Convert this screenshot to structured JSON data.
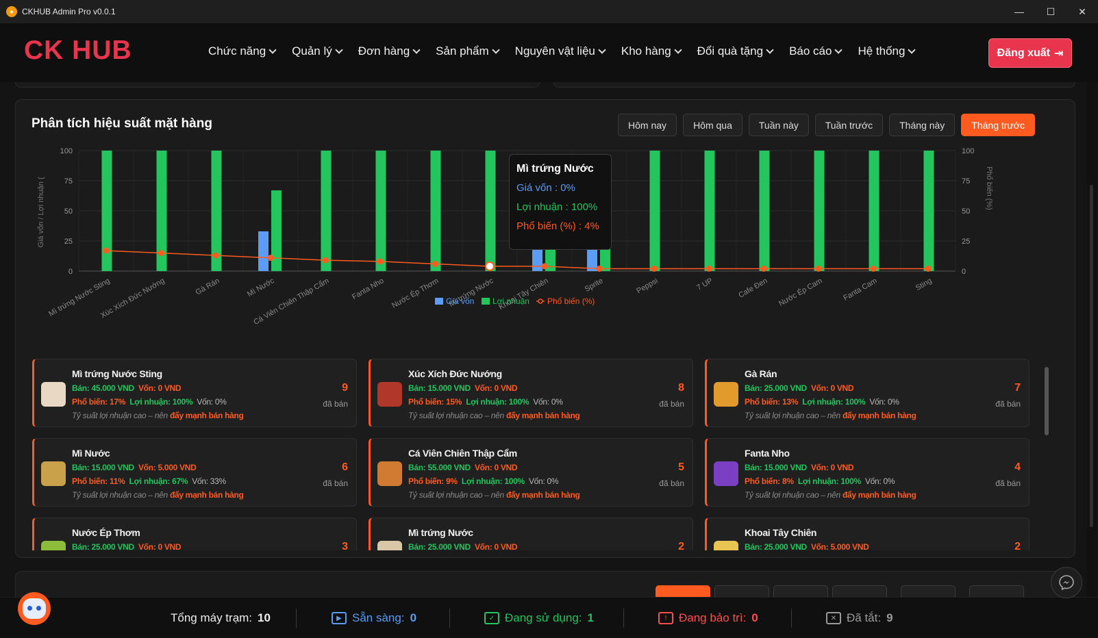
{
  "window": {
    "title": "CKHUB Admin Pro v0.0.1",
    "min": "—",
    "max": "☐",
    "close": "✕"
  },
  "nav": {
    "logo": "CK HUB",
    "menu": [
      "Chức năng",
      "Quản lý",
      "Đơn hàng",
      "Sản phẩm",
      "Nguyên vật liệu",
      "Kho hàng",
      "Đổi quà tặng",
      "Báo cáo",
      "Hệ thống"
    ],
    "logout": "Đăng xuất"
  },
  "panel": {
    "title": "Phân tích hiệu suất mặt hàng",
    "filters": [
      "Hôm nay",
      "Hôm qua",
      "Tuần này",
      "Tuần trước",
      "Tháng này",
      "Tháng trước"
    ],
    "active_filter": "Tháng trước"
  },
  "chart_data": {
    "type": "bar",
    "categories": [
      "Mì trứng Nước Sting",
      "Xúc Xích Đức Nướng",
      "Gà Rán",
      "Mì Nước",
      "Cá Viên Chiên Thập Cẩm",
      "Fanta Nho",
      "Nước Ép Thơm",
      "Mì trứng Nước",
      "Khoai Tây Chiên",
      "Sprite",
      "Peppsi",
      "7 UP",
      "Cafe Đen",
      "Nước Ép Cam",
      "Fanta Cam",
      "Sting"
    ],
    "series": [
      {
        "name": "Giá vốn",
        "type": "bar",
        "axis": "left",
        "color": "#5b9cf5",
        "values": [
          0,
          0,
          0,
          33,
          0,
          0,
          0,
          0,
          20,
          23,
          0,
          0,
          0,
          0,
          0,
          0
        ]
      },
      {
        "name": "Lợi nhuận",
        "type": "bar",
        "axis": "left",
        "color": "#22c55e",
        "values": [
          100,
          100,
          100,
          67,
          100,
          100,
          100,
          100,
          80,
          57,
          100,
          100,
          100,
          100,
          100,
          100
        ]
      },
      {
        "name": "Phổ biến (%)",
        "type": "line",
        "axis": "right",
        "color": "#ff5a1f",
        "values": [
          17,
          15,
          13,
          11,
          9,
          8,
          6,
          4,
          4,
          2,
          2,
          2,
          2,
          2,
          2,
          2
        ]
      }
    ],
    "ylabel": "Giá vốn / Lợi nhuận (",
    "y2label": "Phổ biến (%)",
    "ylim": [
      0,
      100
    ],
    "y2lim": [
      0,
      100
    ],
    "yticks": [
      0,
      25,
      50,
      75,
      100
    ],
    "legend": "bottom-center",
    "highlight_index": 7
  },
  "tooltip": {
    "title": "Mì trứng Nước",
    "rows": [
      "Giá vốn : 0%",
      "Lợi nhuận : 100%",
      "Phổ biến (%) : 4%"
    ]
  },
  "cards": [
    {
      "name": "Mì trứng Nước Sting",
      "sell": "Bán: 45.000 VND",
      "cost": "Vốn: 0 VND",
      "pop": "Phổ biến: 17%",
      "profit": "Lợi nhuận: 100%",
      "costpct": "Vốn: 0%",
      "note": "Tỷ suất lợi nhuận cao – nên ",
      "action": "đẩy mạnh bán hàng",
      "count": "9",
      "sold": "đã bán",
      "thumb_color": "#e9d9c4"
    },
    {
      "name": "Xúc Xích Đức Nướng",
      "sell": "Bán: 15.000 VND",
      "cost": "Vốn: 0 VND",
      "pop": "Phổ biến: 15%",
      "profit": "Lợi nhuận: 100%",
      "costpct": "Vốn: 0%",
      "note": "Tỷ suất lợi nhuận cao – nên ",
      "action": "đẩy mạnh bán hàng",
      "count": "8",
      "sold": "đã bán",
      "thumb_color": "#b0382a"
    },
    {
      "name": "Gà Rán",
      "sell": "Bán: 25.000 VND",
      "cost": "Vốn: 0 VND",
      "pop": "Phổ biến: 13%",
      "profit": "Lợi nhuận: 100%",
      "costpct": "Vốn: 0%",
      "note": "Tỷ suất lợi nhuận cao – nên ",
      "action": "đẩy mạnh bán hàng",
      "count": "7",
      "sold": "đã bán",
      "thumb_color": "#e39a2c"
    },
    {
      "name": "Mì Nước",
      "sell": "Bán: 15.000 VND",
      "cost": "Vốn: 5.000 VND",
      "pop": "Phổ biến: 11%",
      "profit": "Lợi nhuận: 67%",
      "costpct": "Vốn: 33%",
      "note": "Tỷ suất lợi nhuận cao – nên ",
      "action": "đẩy mạnh bán hàng",
      "count": "6",
      "sold": "đã bán",
      "thumb_color": "#c9a14a"
    },
    {
      "name": "Cá Viên Chiên Thập Cẩm",
      "sell": "Bán: 55.000 VND",
      "cost": "Vốn: 0 VND",
      "pop": "Phổ biến: 9%",
      "profit": "Lợi nhuận: 100%",
      "costpct": "Vốn: 0%",
      "note": "Tỷ suất lợi nhuận cao – nên ",
      "action": "đẩy mạnh bán hàng",
      "count": "5",
      "sold": "đã bán",
      "thumb_color": "#d07a32"
    },
    {
      "name": "Fanta Nho",
      "sell": "Bán: 15.000 VND",
      "cost": "Vốn: 0 VND",
      "pop": "Phổ biến: 8%",
      "profit": "Lợi nhuận: 100%",
      "costpct": "Vốn: 0%",
      "note": "Tỷ suất lợi nhuận cao – nên ",
      "action": "đẩy mạnh bán hàng",
      "count": "4",
      "sold": "đã bán",
      "thumb_color": "#7a3fc2"
    },
    {
      "name": "Nước Ép Thơm",
      "sell": "Bán: 25.000 VND",
      "cost": "Vốn: 0 VND",
      "pop": "",
      "profit": "",
      "costpct": "",
      "note": "",
      "action": "",
      "count": "3",
      "sold": "",
      "thumb_color": "#8dbb3a"
    },
    {
      "name": "Mì trứng Nước",
      "sell": "Bán: 25.000 VND",
      "cost": "Vốn: 0 VND",
      "pop": "",
      "profit": "",
      "costpct": "",
      "note": "",
      "action": "",
      "count": "2",
      "sold": "",
      "thumb_color": "#d8c8a8"
    },
    {
      "name": "Khoai Tây Chiên",
      "sell": "Bán: 25.000 VND",
      "cost": "Vốn: 5.000 VND",
      "pop": "",
      "profit": "",
      "costpct": "",
      "note": "",
      "action": "",
      "count": "2",
      "sold": "",
      "thumb_color": "#e8c452"
    }
  ],
  "status": {
    "total_label": "Tổng máy trạm:",
    "total": "10",
    "ready_label": "Sẵn sàng:",
    "ready": "0",
    "inuse_label": "Đang sử dụng:",
    "inuse": "1",
    "maint_label": "Đang bảo trì:",
    "maint": "0",
    "off_label": "Đã tắt:",
    "off": "9"
  },
  "colors": {
    "accent": "#ff5a1f",
    "brand": "#e8344c",
    "profit": "#22c55e",
    "cost": "#5b9cf5"
  }
}
